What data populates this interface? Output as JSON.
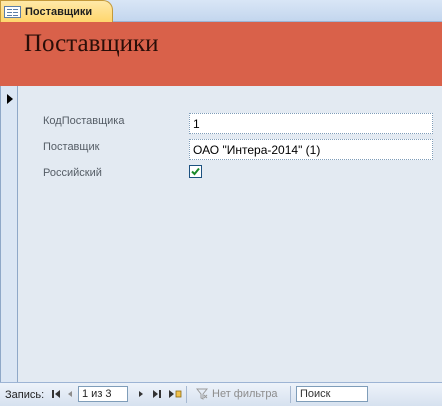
{
  "tab": {
    "label": "Поставщики",
    "icon": "form-icon"
  },
  "header": {
    "title": "Поставщики",
    "background": "#d9614a"
  },
  "form": {
    "fields": [
      {
        "label": "КодПоставщика",
        "value": "1"
      },
      {
        "label": "Поставщик",
        "value": "ОАО \"Интера-2014\" (1)"
      },
      {
        "label": "Российский",
        "checked": true
      }
    ]
  },
  "navigation": {
    "record_label": "Запись:",
    "position": "1 из 3",
    "filter_label": "Нет фильтра",
    "search_placeholder": "Поиск"
  }
}
